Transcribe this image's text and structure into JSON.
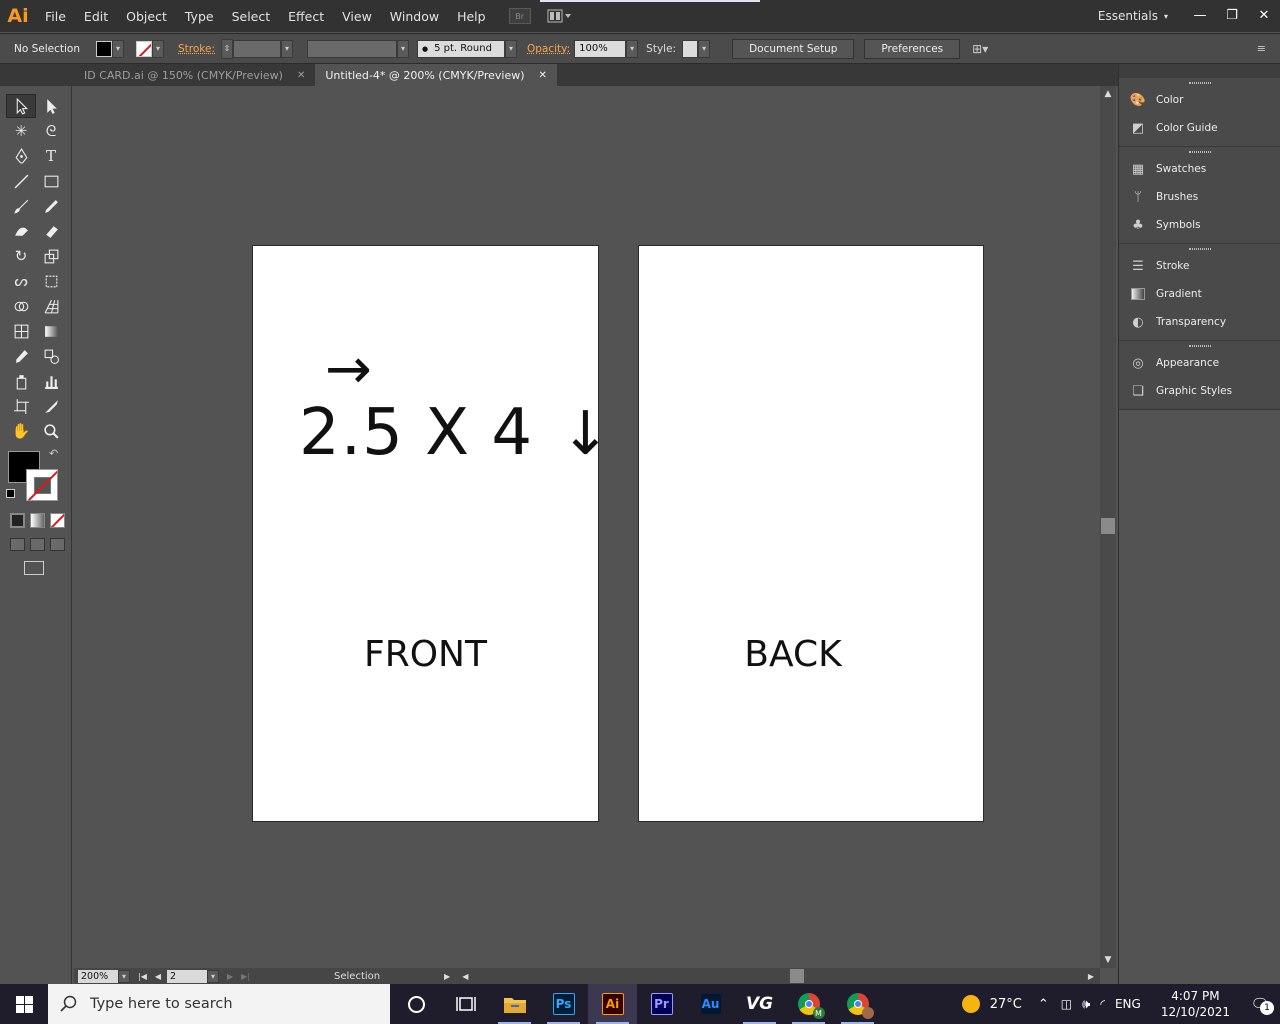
{
  "app": {
    "logo": "Ai"
  },
  "menu": [
    "File",
    "Edit",
    "Object",
    "Type",
    "Select",
    "Effect",
    "View",
    "Window",
    "Help"
  ],
  "menubar_extras": {
    "bridge_label": "Br"
  },
  "workspace": {
    "label": "Essentials",
    "arrow": "▾"
  },
  "window_controls": {
    "minimize": "—",
    "restore": "❐",
    "close": "✕"
  },
  "controlbar": {
    "selection_label": "No Selection",
    "stroke_label": "Stroke:",
    "brush_label": "5 pt. Round",
    "opacity_label": "Opacity:",
    "opacity_value": "100%",
    "style_label": "Style:",
    "document_setup": "Document Setup",
    "preferences": "Preferences"
  },
  "tabs": [
    {
      "label": "ID CARD.ai @ 150% (CMYK/Preview)",
      "close": "✕"
    },
    {
      "label": "Untitled-4* @ 200% (CMYK/Preview)",
      "close": "✕"
    }
  ],
  "tools": [
    "selection-tool",
    "direct-selection-tool",
    "magic-wand-tool",
    "lasso-tool",
    "pen-tool",
    "type-tool",
    "line-segment-tool",
    "rectangle-tool",
    "paintbrush-tool",
    "pencil-tool",
    "blob-brush-tool",
    "eraser-tool",
    "rotate-tool",
    "scale-tool",
    "warp-tool",
    "free-transform-tool",
    "shape-builder-tool",
    "perspective-grid-tool",
    "mesh-tool",
    "gradient-tool",
    "eyedropper-tool",
    "blend-tool",
    "symbol-sprayer-tool",
    "column-graph-tool",
    "artboard-tool",
    "slice-tool",
    "hand-tool",
    "zoom-tool"
  ],
  "artboards": {
    "front": {
      "heading": "2.5 X 4",
      "arrow_right": "→",
      "arrow_down": "↓",
      "label": "FRONT"
    },
    "back": {
      "label": "BACK"
    }
  },
  "statusbar": {
    "zoom": "200%",
    "page": "2",
    "tool": "Selection"
  },
  "panels": [
    {
      "items": [
        {
          "icon": "color-icon",
          "label": "Color"
        },
        {
          "icon": "color-guide-icon",
          "label": "Color Guide"
        }
      ]
    },
    {
      "items": [
        {
          "icon": "swatches-icon",
          "label": "Swatches"
        },
        {
          "icon": "brushes-icon",
          "label": "Brushes"
        },
        {
          "icon": "symbols-icon",
          "label": "Symbols"
        }
      ]
    },
    {
      "items": [
        {
          "icon": "stroke-icon",
          "label": "Stroke"
        },
        {
          "icon": "gradient-icon",
          "label": "Gradient"
        },
        {
          "icon": "transparency-icon",
          "label": "Transparency"
        }
      ]
    },
    {
      "items": [
        {
          "icon": "appearance-icon",
          "label": "Appearance"
        },
        {
          "icon": "graphic-styles-icon",
          "label": "Graphic Styles"
        }
      ]
    }
  ],
  "taskbar": {
    "search_placeholder": "Type here to search",
    "apps": [
      {
        "name": "cortana",
        "label": ""
      },
      {
        "name": "task-view",
        "label": ""
      },
      {
        "name": "file-explorer",
        "label": ""
      },
      {
        "name": "photoshop",
        "label": "Ps",
        "color": "#31a8ff"
      },
      {
        "name": "illustrator",
        "label": "Ai",
        "color": "#ff9a00"
      },
      {
        "name": "premiere",
        "label": "Pr",
        "color": "#9999ff"
      },
      {
        "name": "audition",
        "label": "Au",
        "color": "#2c8cff"
      },
      {
        "name": "vg-app",
        "label": "VG"
      },
      {
        "name": "chrome-profile-m",
        "label": "M"
      },
      {
        "name": "chrome",
        "label": ""
      }
    ],
    "weather": "27°C",
    "language": "ENG",
    "time": "4:07 PM",
    "date": "12/10/2021",
    "notification_count": "1"
  },
  "colors": {
    "illustrator_orange": "#f79a1e",
    "canvas_bg": "#535353",
    "menubar_bg": "#323232",
    "taskbar_bg": "#1f1d2b"
  }
}
